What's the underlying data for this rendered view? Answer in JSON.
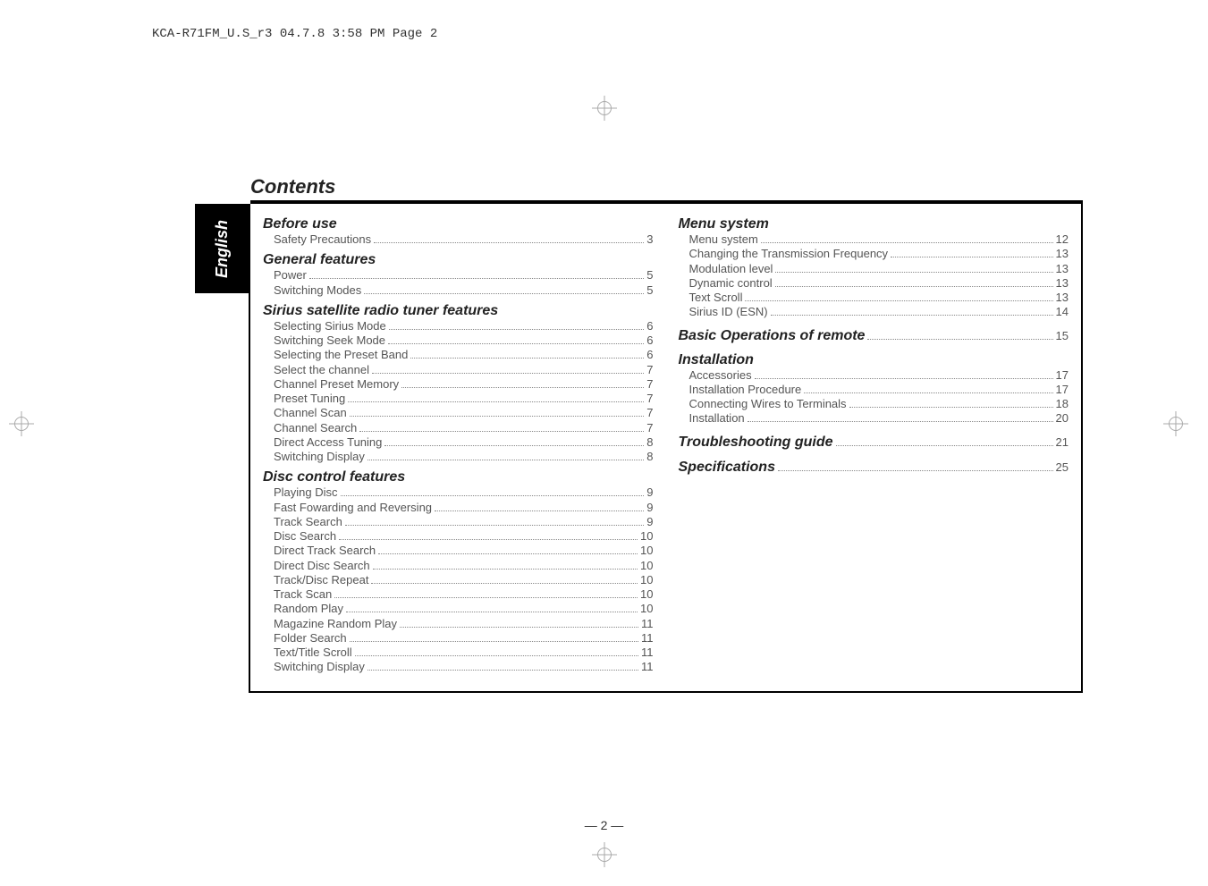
{
  "header_info": "KCA-R71FM_U.S_r3  04.7.8  3:58 PM  Page 2",
  "title": "Contents",
  "side_tab": "English",
  "page_footer": "— 2 —",
  "left_col": {
    "sections": [
      {
        "heading": "Before use",
        "items": [
          {
            "label": "Safety Precautions",
            "page": "3"
          }
        ]
      },
      {
        "heading": "General features",
        "items": [
          {
            "label": "Power",
            "page": "5"
          },
          {
            "label": "Switching Modes",
            "page": "5"
          }
        ]
      },
      {
        "heading": "Sirius satellite radio tuner features",
        "items": [
          {
            "label": "Selecting Sirius Mode",
            "page": "6"
          },
          {
            "label": "Switching Seek Mode",
            "page": "6"
          },
          {
            "label": "Selecting the Preset Band",
            "page": "6"
          },
          {
            "label": "Select the channel",
            "page": "7"
          },
          {
            "label": "Channel Preset Memory",
            "page": "7"
          },
          {
            "label": "Preset Tuning",
            "page": "7"
          },
          {
            "label": "Channel Scan",
            "page": "7"
          },
          {
            "label": "Channel  Search",
            "page": "7"
          },
          {
            "label": "Direct Access Tuning",
            "page": "8"
          },
          {
            "label": "Switching Display",
            "page": "8"
          }
        ]
      },
      {
        "heading": "Disc control features",
        "items": [
          {
            "label": "Playing Disc",
            "page": "9"
          },
          {
            "label": "Fast Fowarding and Reversing",
            "page": "9"
          },
          {
            "label": "Track Search",
            "page": "9"
          },
          {
            "label": "Disc Search",
            "page": "10"
          },
          {
            "label": "Direct Track Search",
            "page": "10"
          },
          {
            "label": "Direct Disc Search",
            "page": "10"
          },
          {
            "label": "Track/Disc Repeat",
            "page": "10"
          },
          {
            "label": "Track Scan",
            "page": "10"
          },
          {
            "label": "Random Play",
            "page": "10"
          },
          {
            "label": "Magazine Random Play",
            "page": "11"
          },
          {
            "label": "Folder Search",
            "page": "11"
          },
          {
            "label": "Text/Title Scroll",
            "page": "11"
          },
          {
            "label": "Switching Display",
            "page": "11"
          }
        ]
      }
    ]
  },
  "right_col": {
    "sections": [
      {
        "heading": "Menu system",
        "items": [
          {
            "label": "Menu system",
            "page": "12"
          },
          {
            "label": "Changing the Transmission Frequency",
            "page": "13"
          },
          {
            "label": "Modulation level",
            "page": "13"
          },
          {
            "label": "Dynamic control",
            "page": "13"
          },
          {
            "label": "Text Scroll",
            "page": "13"
          },
          {
            "label": "Sirius ID (ESN)",
            "page": "14"
          }
        ]
      },
      {
        "heading_row": {
          "label": "Basic Operations of remote",
          "page": "15"
        }
      },
      {
        "heading": "Installation",
        "items": [
          {
            "label": "Accessories",
            "page": "17"
          },
          {
            "label": "Installation Procedure",
            "page": "17"
          },
          {
            "label": "Connecting Wires to Terminals",
            "page": "18"
          },
          {
            "label": "Installation",
            "page": "20"
          }
        ]
      },
      {
        "heading_row": {
          "label": "Troubleshooting guide",
          "page": "21"
        }
      },
      {
        "heading_row": {
          "label": "Specifications",
          "page": "25"
        }
      }
    ]
  }
}
